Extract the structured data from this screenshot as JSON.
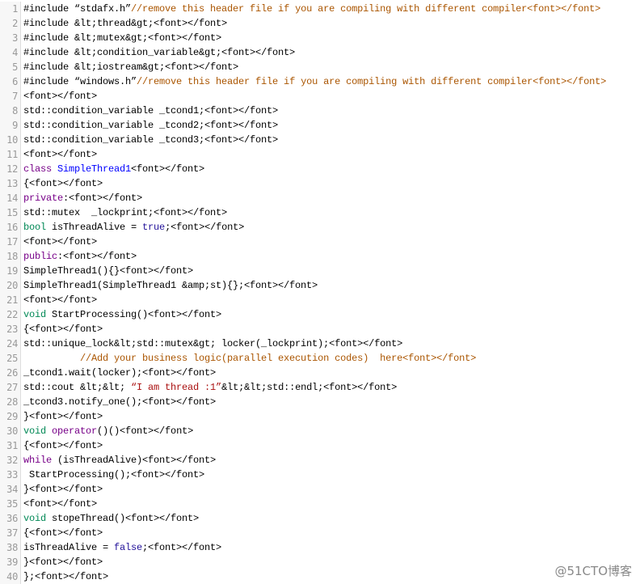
{
  "code_lines": [
    [
      [
        "",
        "#include “stdafx.h”"
      ],
      [
        "c",
        "//remove this header file if you are compiling with different compiler<font></font>"
      ]
    ],
    [
      [
        "",
        "#include &lt;thread&gt;<font></font>"
      ]
    ],
    [
      [
        "",
        "#include &lt;mutex&gt;<font></font>"
      ]
    ],
    [
      [
        "",
        "#include &lt;condition_variable&gt;<font></font>"
      ]
    ],
    [
      [
        "",
        "#include &lt;iostream&gt;<font></font>"
      ]
    ],
    [
      [
        "",
        "#include “windows.h”"
      ],
      [
        "c",
        "//remove this header file if you are compiling with different compiler<font></font>"
      ]
    ],
    [
      [
        "",
        "<font></font>"
      ]
    ],
    [
      [
        "",
        "std::condition_variable _tcond1;<font></font>"
      ]
    ],
    [
      [
        "",
        "std::condition_variable _tcond2;<font></font>"
      ]
    ],
    [
      [
        "",
        "std::condition_variable _tcond3;<font></font>"
      ]
    ],
    [
      [
        "",
        "<font></font>"
      ]
    ],
    [
      [
        "k",
        "class"
      ],
      [
        "",
        " "
      ],
      [
        "d",
        "SimpleThread1"
      ],
      [
        "",
        "<font></font>"
      ]
    ],
    [
      [
        "",
        "{<font></font>"
      ]
    ],
    [
      [
        "k",
        "private"
      ],
      [
        "",
        ":<font></font>"
      ]
    ],
    [
      [
        "",
        "std::mutex  _lockprint;<font></font>"
      ]
    ],
    [
      [
        "t",
        "bool"
      ],
      [
        "",
        " isThreadAlive = "
      ],
      [
        "a",
        "true"
      ],
      [
        "",
        ";<font></font>"
      ]
    ],
    [
      [
        "",
        "<font></font>"
      ]
    ],
    [
      [
        "k",
        "public"
      ],
      [
        "",
        ":<font></font>"
      ]
    ],
    [
      [
        "",
        "SimpleThread1(){}<font></font>"
      ]
    ],
    [
      [
        "",
        "SimpleThread1(SimpleThread1 &amp;st){};<font></font>"
      ]
    ],
    [
      [
        "",
        "<font></font>"
      ]
    ],
    [
      [
        "t",
        "void"
      ],
      [
        "",
        " StartProcessing()<font></font>"
      ]
    ],
    [
      [
        "",
        "{<font></font>"
      ]
    ],
    [
      [
        "",
        "std::unique_lock&lt;std::mutex&gt; locker(_lockprint);<font></font>"
      ]
    ],
    [
      [
        "",
        "          "
      ],
      [
        "c",
        "//Add your business logic(parallel execution codes)  here<font></font>"
      ]
    ],
    [
      [
        "",
        "_tcond1.wait(locker);<font></font>"
      ]
    ],
    [
      [
        "",
        "std::cout &lt;&lt; "
      ],
      [
        "s",
        "“I am thread :1”"
      ],
      [
        "",
        "&lt;&lt;std::endl;<font></font>"
      ]
    ],
    [
      [
        "",
        "_tcond3.notify_one();<font></font>"
      ]
    ],
    [
      [
        "",
        "}<font></font>"
      ]
    ],
    [
      [
        "t",
        "void"
      ],
      [
        "",
        " "
      ],
      [
        "k",
        "operator"
      ],
      [
        "",
        "()()<font></font>"
      ]
    ],
    [
      [
        "",
        "{<font></font>"
      ]
    ],
    [
      [
        "k",
        "while"
      ],
      [
        "",
        " (isThreadAlive)<font></font>"
      ]
    ],
    [
      [
        "",
        " StartProcessing();<font></font>"
      ]
    ],
    [
      [
        "",
        "}<font></font>"
      ]
    ],
    [
      [
        "",
        "<font></font>"
      ]
    ],
    [
      [
        "t",
        "void"
      ],
      [
        "",
        " stopeThread()<font></font>"
      ]
    ],
    [
      [
        "",
        "{<font></font>"
      ]
    ],
    [
      [
        "",
        "isThreadAlive = "
      ],
      [
        "a",
        "false"
      ],
      [
        "",
        ";<font></font>"
      ]
    ],
    [
      [
        "",
        "}<font></font>"
      ]
    ],
    [
      [
        "",
        "};<font></font>"
      ]
    ]
  ],
  "watermark": "@51CTO博客"
}
